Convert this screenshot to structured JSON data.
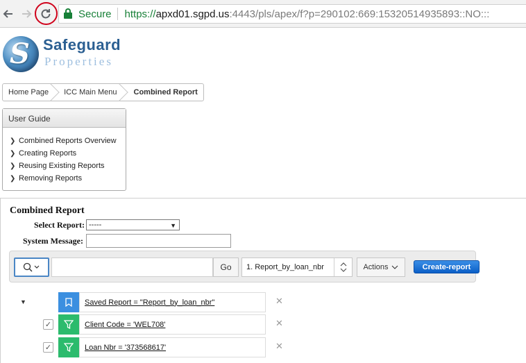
{
  "browser": {
    "secure_label": "Secure",
    "url_scheme": "https://",
    "url_host": "apxd01.sgpd.us",
    "url_path": ":4443/pls/apex/f?p=290102:669:15320514935893::NO:::"
  },
  "logo": {
    "name": "Safeguard",
    "subtitle": "Properties",
    "initial": "S"
  },
  "breadcrumb": {
    "items": [
      {
        "label": "Home Page"
      },
      {
        "label": "ICC Main Menu"
      },
      {
        "label": "Combined Report"
      }
    ]
  },
  "guide": {
    "title": "User Guide",
    "items": [
      {
        "label": "Combined Reports Overview"
      },
      {
        "label": "Creating Reports"
      },
      {
        "label": "Reusing Existing Reports"
      },
      {
        "label": "Removing Reports"
      }
    ]
  },
  "form": {
    "title": "Combined Report",
    "select_label": "Select Report:",
    "select_value": "-----",
    "sys_label": "System Message:"
  },
  "toolbar": {
    "go_label": "Go",
    "report_value": "1. Report_by_loan_nbr",
    "actions_label": "Actions",
    "create_label": "Create-report"
  },
  "filters": {
    "saved": "Saved Report = \"Report_by_loan_nbr\"",
    "items": [
      {
        "label": "Client Code = 'WEL708'"
      },
      {
        "label": "Loan Nbr = '373568617'"
      }
    ]
  },
  "icons": {
    "back": "arrow-left-icon",
    "forward": "arrow-right-icon",
    "reload": "reload-icon",
    "lock": "lock-icon",
    "search": "magnifier-icon",
    "bookmark": "bookmark-icon",
    "filter": "funnel-icon",
    "close": "close-icon"
  },
  "colors": {
    "secure_green": "#188038",
    "highlight_red": "#d0021b",
    "primary_blue": "#0b5fc7",
    "filter_blue": "#3b8fe0",
    "filter_green": "#2cbb6d"
  }
}
